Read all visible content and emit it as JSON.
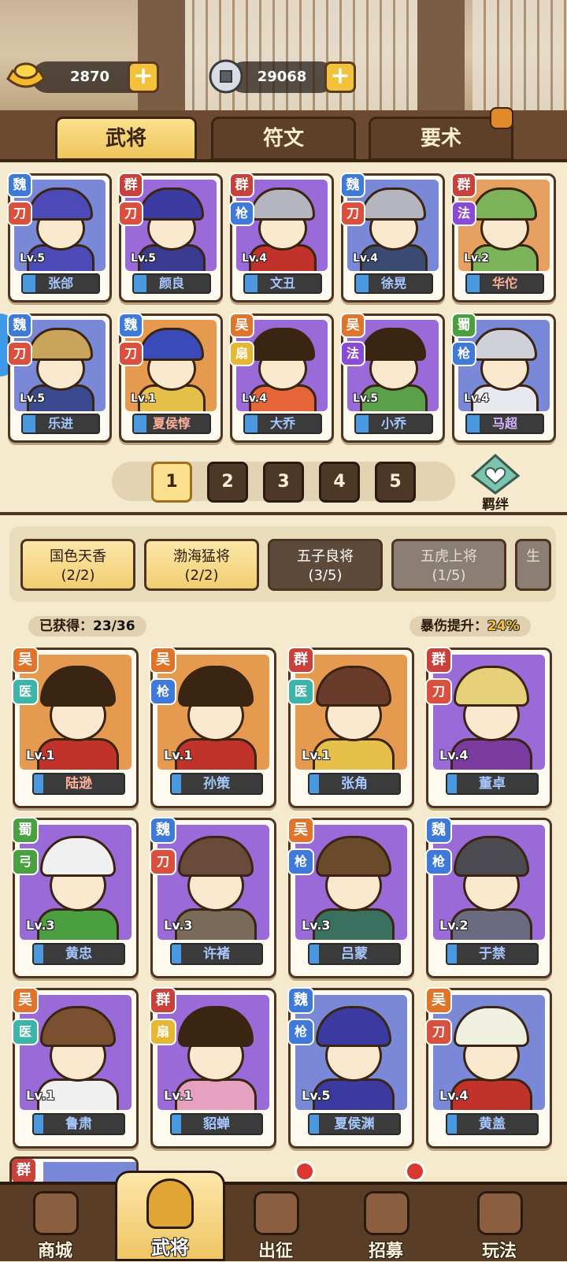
{
  "currency": {
    "gold": "2870",
    "coin": "29068"
  },
  "tabs": [
    "武将",
    "符文",
    "要术"
  ],
  "roster": [
    {
      "name": "张郃",
      "lv": "Lv.5",
      "faction": "魏",
      "fc": "wei",
      "type": "blade",
      "bg": "#7a88d8",
      "helm": "#4b4ab8",
      "body": "#4b4ab8",
      "nc": ""
    },
    {
      "name": "颜良",
      "lv": "Lv.5",
      "faction": "群",
      "fc": "qun",
      "type": "blade",
      "bg": "#9a6ad8",
      "helm": "#3a3aa0",
      "body": "#3a3a90",
      "nc": ""
    },
    {
      "name": "文丑",
      "lv": "Lv.4",
      "faction": "群",
      "fc": "qun",
      "type": "spear",
      "bg": "#9a6ad8",
      "helm": "#b5b5c0",
      "body": "#c0322a",
      "nc": ""
    },
    {
      "name": "徐晃",
      "lv": "Lv.4",
      "faction": "魏",
      "fc": "wei",
      "type": "blade",
      "bg": "#7a88d8",
      "helm": "#b5b5c0",
      "body": "#3a4a70",
      "nc": ""
    },
    {
      "name": "华佗",
      "lv": "Lv.2",
      "faction": "群",
      "fc": "qun",
      "type": "magic",
      "bg": "#e6a060",
      "helm": "#7cb35a",
      "body": "#7cb35a",
      "nc": "red"
    },
    {
      "name": "乐进",
      "lv": "Lv.5",
      "faction": "魏",
      "fc": "wei",
      "type": "blade",
      "bg": "#7a88d8",
      "helm": "#c9a45a",
      "body": "#3a4a90",
      "nc": ""
    },
    {
      "name": "夏侯惇",
      "lv": "Lv.1",
      "faction": "魏",
      "fc": "wei",
      "type": "blade",
      "bg": "#e69a50",
      "helm": "#3a4ab8",
      "body": "#e6c04a",
      "nc": "red"
    },
    {
      "name": "大乔",
      "lv": "Lv.4",
      "faction": "吴",
      "fc": "wu",
      "type": "fan",
      "bg": "#9a6ad8",
      "helm": "#3a2412",
      "body": "#e6663a",
      "nc": ""
    },
    {
      "name": "小乔",
      "lv": "Lv.5",
      "faction": "吴",
      "fc": "wu",
      "type": "magic",
      "bg": "#9a6ad8",
      "helm": "#3a2412",
      "body": "#5aa04a",
      "nc": ""
    },
    {
      "name": "马超",
      "lv": "Lv.4",
      "faction": "蜀",
      "fc": "shu",
      "type": "spear",
      "bg": "#7a88d8",
      "helm": "#d0d0d8",
      "body": "#e8e8f0",
      "nc": "purple"
    }
  ],
  "pages": [
    "1",
    "2",
    "3",
    "4",
    "5"
  ],
  "bond_label": "羁绊",
  "sets": [
    {
      "name": "国色天香",
      "prog": "(2/2)",
      "state": "done"
    },
    {
      "name": "渤海猛将",
      "prog": "(2/2)",
      "state": "done"
    },
    {
      "name": "五子良将",
      "prog": "(3/5)",
      "state": "part"
    },
    {
      "name": "五虎上将",
      "prog": "(1/5)",
      "state": "lock"
    },
    {
      "name": "生",
      "prog": "",
      "state": "lock"
    }
  ],
  "obtained": {
    "label": "已获得：",
    "value": "23/36"
  },
  "crit": {
    "label": "暴伤提升：",
    "value": "24%"
  },
  "set_heroes": [
    {
      "name": "陆逊",
      "lv": "Lv.1",
      "faction": "吴",
      "fc": "wu",
      "type": "heal",
      "bg": "#e69a50",
      "helm": "#3a2412",
      "body": "#c0322a",
      "nc": "red"
    },
    {
      "name": "孙策",
      "lv": "Lv.1",
      "faction": "吴",
      "fc": "wu",
      "type": "spear",
      "bg": "#e69a50",
      "helm": "#3a2412",
      "body": "#c0322a",
      "nc": ""
    },
    {
      "name": "张角",
      "lv": "Lv.1",
      "faction": "群",
      "fc": "qun",
      "type": "heal",
      "bg": "#e69a50",
      "helm": "#6a3a2a",
      "body": "#e6c04a",
      "nc": ""
    },
    {
      "name": "董卓",
      "lv": "Lv.4",
      "faction": "群",
      "fc": "qun",
      "type": "blade",
      "bg": "#9a6ad8",
      "helm": "#e6d07a",
      "body": "#7a3aa0",
      "nc": ""
    },
    {
      "name": "黄忠",
      "lv": "Lv.3",
      "faction": "蜀",
      "fc": "shu",
      "type": "bow",
      "bg": "#9a6ad8",
      "helm": "#f0f0f0",
      "body": "#4aa041",
      "nc": ""
    },
    {
      "name": "许褚",
      "lv": "Lv.3",
      "faction": "魏",
      "fc": "wei",
      "type": "blade",
      "bg": "#9a6ad8",
      "helm": "#6a4a3a",
      "body": "#7a6a5a",
      "nc": ""
    },
    {
      "name": "吕蒙",
      "lv": "Lv.3",
      "faction": "吴",
      "fc": "wu",
      "type": "spear",
      "bg": "#9a6ad8",
      "helm": "#6a4a2a",
      "body": "#3a7060",
      "nc": ""
    },
    {
      "name": "于禁",
      "lv": "Lv.2",
      "faction": "魏",
      "fc": "wei",
      "type": "spear",
      "bg": "#9a6ad8",
      "helm": "#4a4a50",
      "body": "#6a6a80",
      "nc": ""
    },
    {
      "name": "鲁肃",
      "lv": "Lv.1",
      "faction": "吴",
      "fc": "wu",
      "type": "heal",
      "bg": "#9a6ad8",
      "helm": "#7a5030",
      "body": "#f0f0f0",
      "nc": ""
    },
    {
      "name": "貂蝉",
      "lv": "Lv.1",
      "faction": "群",
      "fc": "qun",
      "type": "fan",
      "bg": "#9a6ad8",
      "helm": "#3a2412",
      "body": "#e6a0c0",
      "nc": ""
    },
    {
      "name": "夏侯渊",
      "lv": "Lv.5",
      "faction": "魏",
      "fc": "wei",
      "type": "spear",
      "bg": "#7a88d8",
      "helm": "#3a3aa0",
      "body": "#3a3aa0",
      "nc": ""
    },
    {
      "name": "黄盖",
      "lv": "Lv.4",
      "faction": "吴",
      "fc": "wu",
      "type": "blade",
      "bg": "#7a88d8",
      "helm": "#f0f0e0",
      "body": "#c0322a",
      "nc": ""
    }
  ],
  "partial_card": {
    "faction": "群"
  },
  "nav": [
    {
      "label": "商城",
      "icon": "shop-icon"
    },
    {
      "label": "武将",
      "icon": "helmet-icon"
    },
    {
      "label": "出征",
      "icon": "battle-icon"
    },
    {
      "label": "招募",
      "icon": "recruit-icon"
    },
    {
      "label": "玩法",
      "icon": "gameplay-icon"
    }
  ],
  "type_glyphs": {
    "blade": "刀",
    "spear": "枪",
    "magic": "法",
    "fan": "扇",
    "heal": "医",
    "bow": "弓"
  },
  "colors": {
    "accent": "#f4c23a",
    "wood": "#4d3422",
    "parchment": "#f5e9ce"
  }
}
